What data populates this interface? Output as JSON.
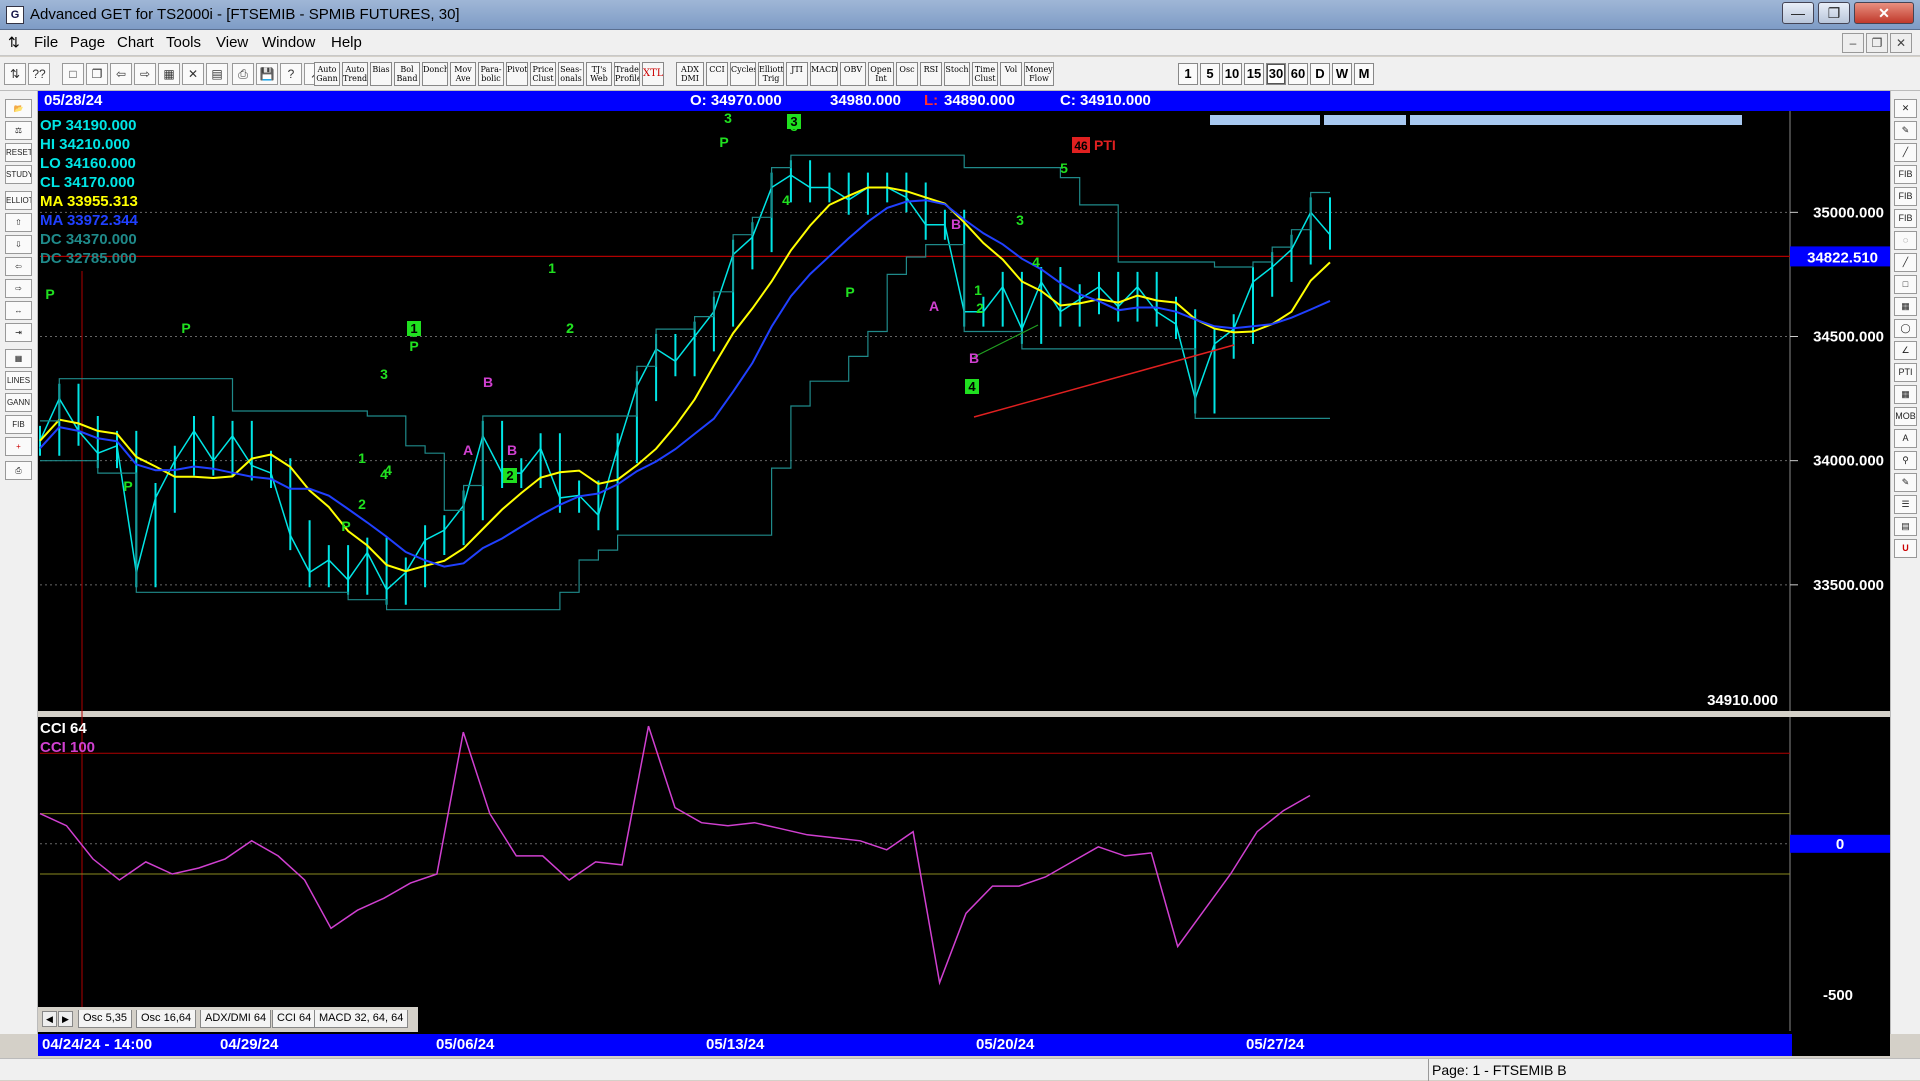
{
  "window": {
    "title": "Advanced GET for TS2000i - [FTSEMIB - SPMIB FUTURES, 30]"
  },
  "menu": {
    "items": [
      "File",
      "Page",
      "Chart",
      "Tools",
      "View",
      "Window",
      "Help"
    ]
  },
  "toolbar": {
    "studies": [
      "Auto Gann",
      "Auto Trend",
      "Bias",
      "Bol Band",
      "Donch",
      "Mov Ave",
      "Para- bolic",
      "Pivot",
      "Price Clust",
      "Seas- onals",
      "TJ's Web",
      "Trade Profile",
      "XTL",
      "ADX DMI",
      "CCI",
      "Cycles",
      "Elliott Trig",
      "JTI",
      "MACD",
      "OBV",
      "Open Int",
      "Osc",
      "RSI",
      "Stoch",
      "Time Clust",
      "Vol",
      "Money Flow"
    ],
    "timeframes": [
      "1",
      "5",
      "10",
      "15",
      "30",
      "60",
      "D",
      "W",
      "M"
    ],
    "active_timeframe": "30"
  },
  "infobar": {
    "date": "05/28/24",
    "open": "O: 34970.000",
    "high": "34980.000",
    "low_label": "L:",
    "low": "34890.000",
    "close": "C: 34910.000"
  },
  "legend": {
    "op": "OP  34190.000",
    "hi": "HI   34210.000",
    "lo": "LO  34160.000",
    "cl": "CL  34170.000",
    "ma1": "MA  33955.313",
    "ma2": "MA  33972.344",
    "dc1": "DC  34370.000",
    "dc2": "DC  32785.000"
  },
  "price_axis": {
    "ticks": [
      "35000.000",
      "34500.000",
      "34000.000",
      "33500.000"
    ],
    "current_price": "34822.510",
    "last_close": "34910.000"
  },
  "cci_panel": {
    "title": "CCI 64",
    "level_label": "CCI  100",
    "ticks": [
      "0",
      "-500"
    ]
  },
  "chart_data": {
    "type": "line",
    "price_range": [
      33000,
      35400
    ],
    "series": [],
    "x": [
      0,
      20,
      40,
      60,
      80,
      100,
      120,
      140,
      160,
      180,
      200,
      220,
      240,
      260,
      280,
      300,
      320,
      340,
      360,
      380,
      400,
      420,
      440,
      460,
      480,
      500,
      520,
      540,
      560,
      580,
      600,
      620,
      640,
      660,
      680
    ],
    "close": [
      34080,
      34250,
      34120,
      34030,
      34060,
      33550,
      33850,
      34000,
      34120,
      34000,
      34100,
      33980,
      33950,
      33700,
      33550,
      33600,
      33520,
      33630,
      33480,
      33550,
      33680,
      33720,
      33820,
      34100,
      33950,
      33950,
      34050,
      33850,
      33860,
      33780,
      34050,
      34300,
      34450,
      34400,
      34500
    ],
    "close_tail": [
      34600,
      34830,
      34900,
      35100,
      35150,
      35100,
      35100,
      35050,
      35100,
      35100,
      35060,
      34950,
      34950,
      34600,
      34600,
      34700,
      34530,
      34720,
      34600,
      34650,
      34700,
      34620,
      34700,
      34600,
      34550,
      34250,
      34470,
      34530,
      34720,
      34780,
      34850,
      35000,
      34910
    ],
    "wave_labels": [
      "P",
      "P",
      "P",
      "P",
      "1",
      "2",
      "3",
      "4",
      "5",
      "P",
      "A",
      "B",
      "B",
      "2",
      "1",
      "2",
      "3",
      "3",
      "P",
      "4",
      "B",
      "P",
      "A",
      "B",
      "1",
      "2",
      "3",
      "4",
      "4",
      "5"
    ],
    "wave_badges": [
      "1",
      "2",
      "3",
      "4"
    ],
    "pti": "46",
    "pti_label": "PTI",
    "cci": [
      100,
      60,
      -50,
      -120,
      -60,
      -100,
      -80,
      -50,
      10,
      -40,
      -120,
      -280,
      -220,
      -180,
      -130,
      -100,
      370,
      100,
      -40,
      -40,
      -120,
      -60,
      -70,
      390,
      120,
      70,
      60,
      70,
      50,
      30,
      20,
      10,
      -20,
      40,
      -460,
      -230,
      -140,
      -140,
      -110,
      -60,
      -10,
      -40,
      -30,
      -340,
      -220,
      -100,
      40,
      110,
      160
    ]
  },
  "tabs": [
    "Osc 5,35",
    "Osc 16,64",
    "ADX/DMI 64",
    "CCI 64",
    "MACD 32, 64, 64"
  ],
  "dates": {
    "start": "04/24/24 - 14:00",
    "labels": [
      "04/29/24",
      "05/06/24",
      "05/13/24",
      "05/20/24",
      "05/27/24"
    ]
  },
  "statusbar": {
    "text": "Page: 1 - FTSEMIB B"
  }
}
